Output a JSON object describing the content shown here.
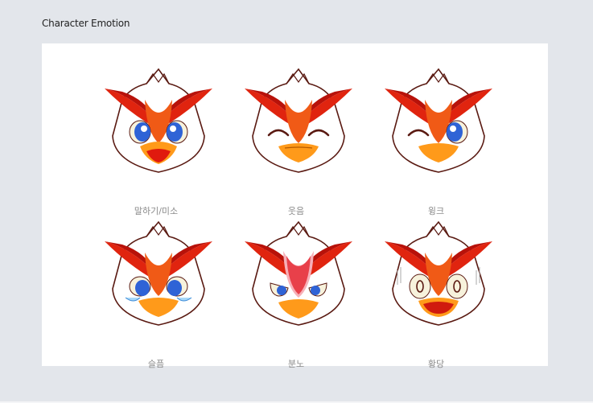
{
  "page": {
    "title": "Character Emotion"
  },
  "emotions": [
    {
      "label": "말하기/미소",
      "eyes": "open-blue",
      "mouth": "talk"
    },
    {
      "label": "웃음",
      "eyes": "closed-happy",
      "mouth": "smile"
    },
    {
      "label": "윙크",
      "eyes": "wink-left",
      "mouth": "smile"
    },
    {
      "label": "슬픔",
      "eyes": "tearful",
      "mouth": "closed"
    },
    {
      "label": "분노",
      "eyes": "angry",
      "mouth": "frown"
    },
    {
      "label": "황당",
      "eyes": "shocked",
      "mouth": "open-shock"
    }
  ],
  "colors": {
    "background": "#e3e6eb",
    "panel": "#ffffff",
    "crest_red": "#d0170e",
    "crest_dark": "#8a0a00",
    "beak": "#ff9a1a",
    "eye_blue": "#2f63d6",
    "outline": "#5a1a12"
  }
}
